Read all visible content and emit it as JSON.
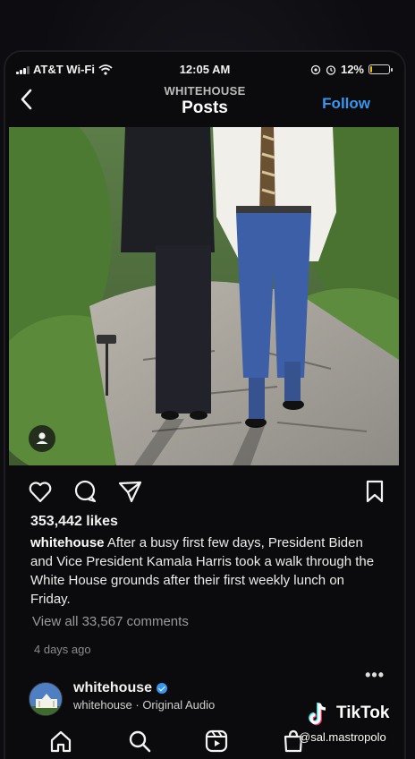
{
  "status_bar": {
    "carrier": "AT&T Wi-Fi",
    "time": "12:05 AM",
    "battery_label": "12%",
    "battery_level": 0.12
  },
  "header": {
    "account": "WHITEHOUSE",
    "title": "Posts",
    "follow_label": "Follow"
  },
  "post": {
    "likes": "353,442 likes",
    "caption_user": "whitehouse",
    "caption_text": "After a busy first few days, President Biden and Vice President Kamala Harris took a walk through the White House grounds after their first weekly lunch on Friday.",
    "comments_link": "View all 33,567 comments",
    "time_ago": "4 days ago"
  },
  "audio": {
    "username": "whitehouse",
    "subtitle": "whitehouse · Original Audio"
  },
  "overlay": {
    "brand": "TikTok",
    "handle": "@sal.mastropolo"
  },
  "colors": {
    "accent": "#3797f0",
    "background": "#0b0b0d",
    "battery": "#f2c200"
  },
  "icons": {
    "back": "chevron-left-icon",
    "like": "heart-icon",
    "comment": "comment-icon",
    "share": "send-icon",
    "save": "bookmark-icon",
    "home": "home-icon",
    "search": "search-icon",
    "reels": "reels-icon",
    "shop": "shop-icon"
  }
}
